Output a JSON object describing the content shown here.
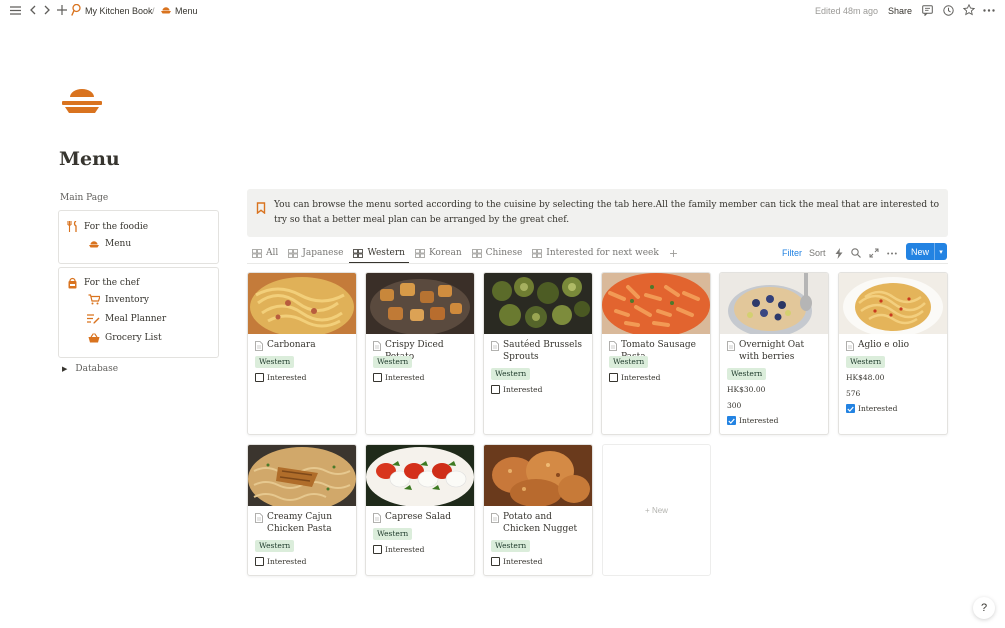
{
  "topbar": {
    "breadcrumb_workspace": "My Kitchen Book",
    "breadcrumb_separator": "/",
    "breadcrumb_page": "Menu",
    "edited": "Edited 48m ago",
    "share": "Share"
  },
  "page": {
    "title": "Menu",
    "icon": "bowl-icon"
  },
  "sidebar": {
    "main_page_label": "Main Page",
    "foodie_header": "For the foodie",
    "foodie_items": [
      "Menu"
    ],
    "chef_header": "For the chef",
    "chef_items": [
      "Inventory",
      "Meal Planner",
      "Grocery List"
    ],
    "database_label": "Database"
  },
  "callout": {
    "text": "You can browse the menu sorted according to the cuisine by selecting the tab here.All the family member can tick the meal that are interested to try so that a better meal plan can be arranged by the great chef."
  },
  "tabs": [
    "All",
    "Japanese",
    "Western",
    "Korean",
    "Chinese",
    "Interested for next week"
  ],
  "active_tab": "Western",
  "toolbar": {
    "filter": "Filter",
    "sort": "Sort",
    "new": "New"
  },
  "cards": [
    {
      "title": "Carbonara",
      "tag": "Western",
      "checkbox_label": "Interested",
      "checked": false
    },
    {
      "title": "Crispy Diced Potato",
      "tag": "Western",
      "checkbox_label": "Interested",
      "checked": false
    },
    {
      "title": "Sautéed Brussels Sprouts",
      "tag": "Western",
      "checkbox_label": "Interested",
      "checked": false
    },
    {
      "title": "Tomato Sausage Pasta",
      "tag": "Western",
      "checkbox_label": "Interested",
      "checked": false
    },
    {
      "title": "Overnight Oat with berries",
      "tag": "Western",
      "price": "HK$30.00",
      "number": "300",
      "checkbox_label": "Interested",
      "checked": true
    },
    {
      "title": "Aglio e olio",
      "tag": "Western",
      "price": "HK$48.00",
      "number": "576",
      "checkbox_label": "Interested",
      "checked": true
    },
    {
      "title": "Creamy Cajun Chicken Pasta",
      "tag": "Western",
      "checkbox_label": "Interested",
      "checked": false
    },
    {
      "title": "Caprese Salad",
      "tag": "Western",
      "checkbox_label": "Interested",
      "checked": false
    },
    {
      "title": "Potato and Chicken Nugget",
      "tag": "Western",
      "checkbox_label": "Interested",
      "checked": false
    }
  ],
  "new_card_label": "+ New",
  "help_label": "?",
  "colors": {
    "accent": "#2383e2",
    "tag_bg": "#dbeddb",
    "brand_orange": "#d9731f",
    "callout_bg": "#f1f1ef"
  }
}
